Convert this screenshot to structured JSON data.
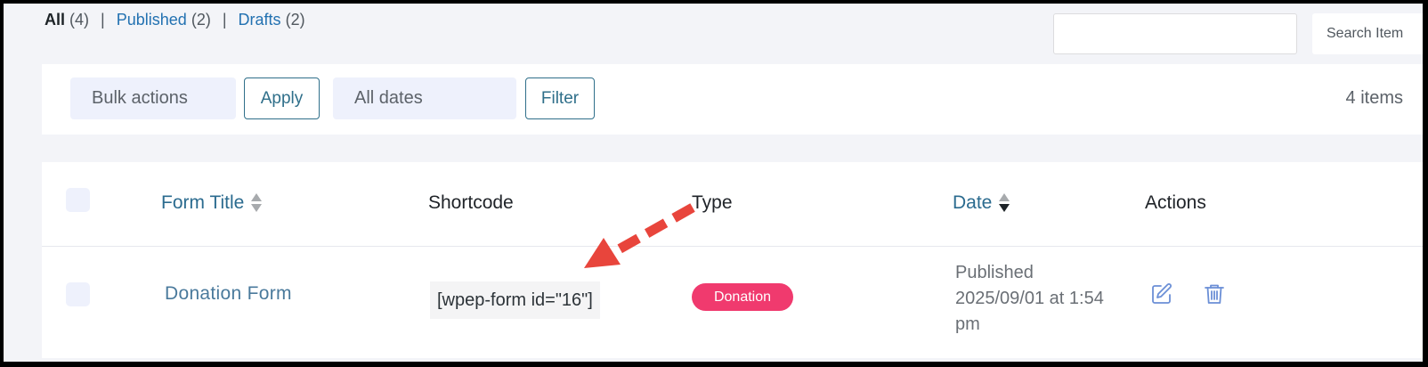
{
  "filters": {
    "all_label": "All",
    "all_count": "(4)",
    "published_label": "Published",
    "published_count": "(2)",
    "drafts_label": "Drafts",
    "drafts_count": "(2)",
    "separator": "|"
  },
  "search": {
    "value": "",
    "button_label": "Search Item"
  },
  "toolbar": {
    "bulk_actions": "Bulk actions",
    "apply_label": "Apply",
    "dates": "All dates",
    "filter_label": "Filter",
    "items_count": "4 items"
  },
  "table": {
    "columns": {
      "title": "Form Title",
      "shortcode": "Shortcode",
      "type": "Type",
      "date": "Date",
      "actions": "Actions"
    },
    "rows": [
      {
        "title": "Donation Form",
        "shortcode": "[wpep-form id=\"16\"]",
        "type": "Donation",
        "date_status": "Published",
        "date_line1": "2025/09/01 at 1:54",
        "date_line2": "pm"
      }
    ]
  },
  "icons": {
    "edit": "edit-icon",
    "delete": "trash-icon",
    "sort": "sort-icon"
  },
  "colors": {
    "link": "#2271b1",
    "badge": "#f03a6e",
    "annotation_arrow": "#e8453c",
    "action_icon": "#6b8fd6"
  }
}
